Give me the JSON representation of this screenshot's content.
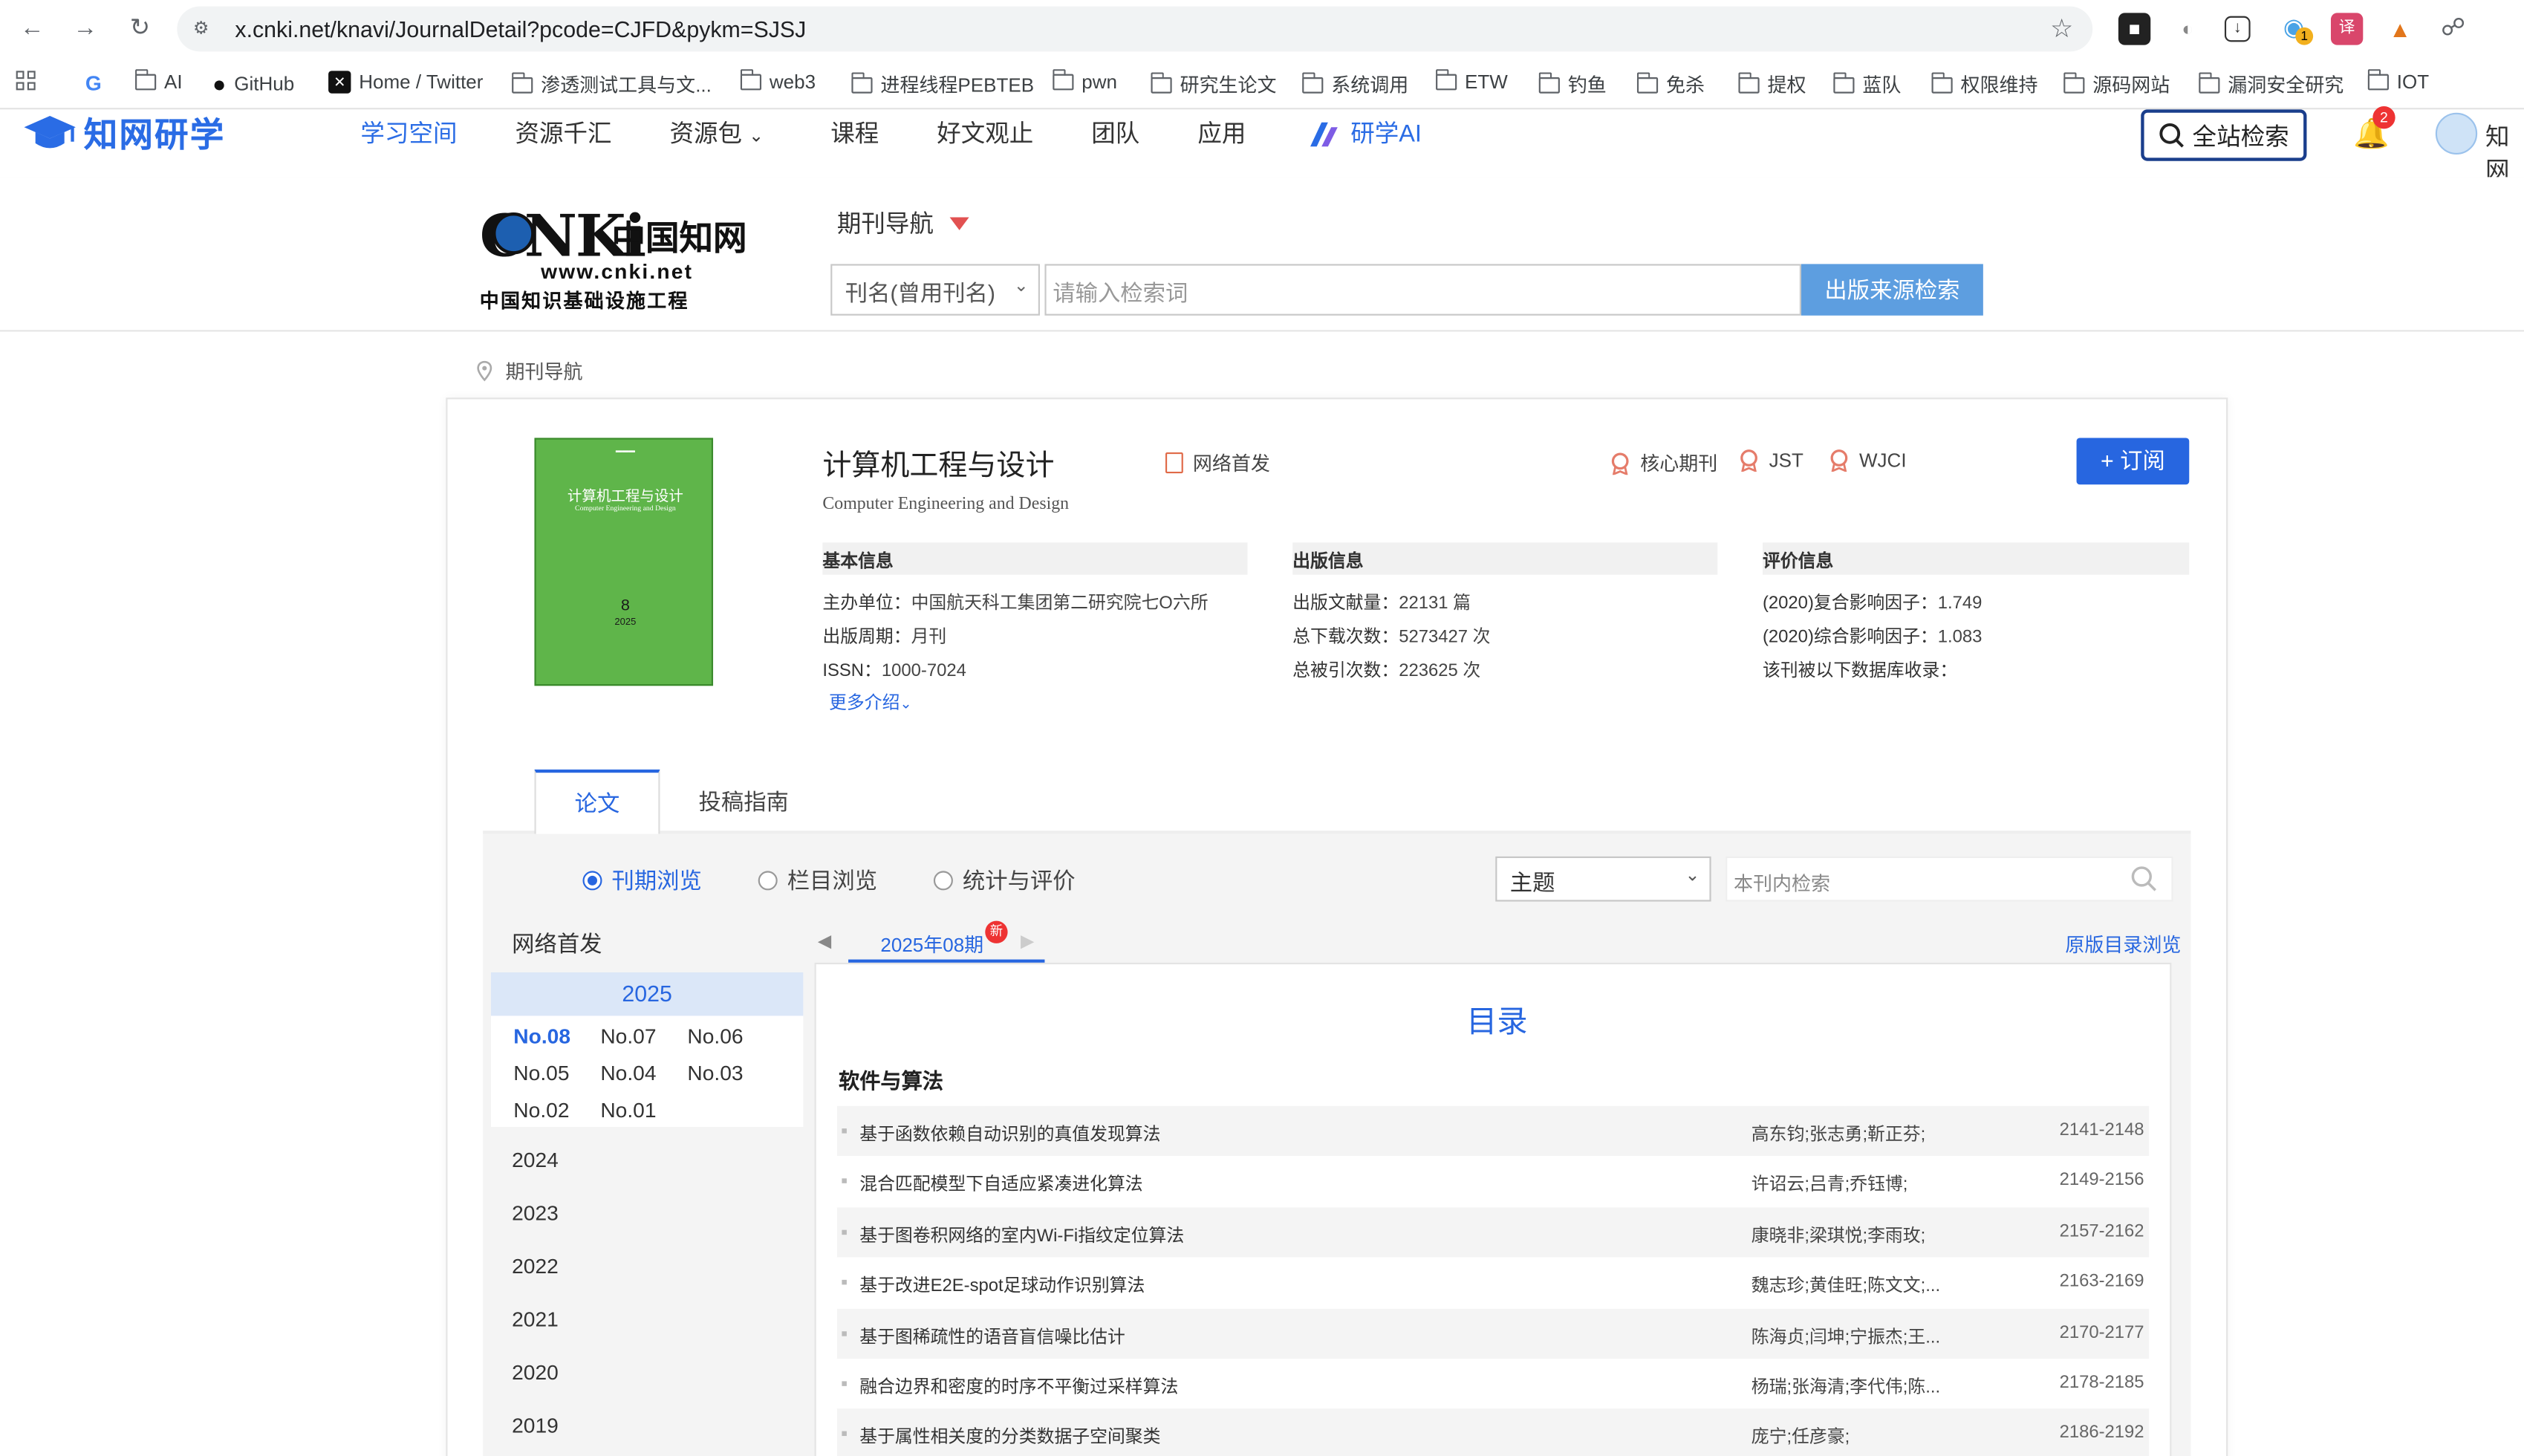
{
  "browser": {
    "url": "x.cnki.net/knavi/JournalDetail?pcode=CJFD&pykm=SJSJ",
    "bookmarks": [
      {
        "label": "AI",
        "icon": "folder-icon"
      },
      {
        "label": "GitHub",
        "icon": "github-icon"
      },
      {
        "label": "Home / Twitter",
        "icon": "x-icon"
      },
      {
        "label": "渗透测试工具与文...",
        "icon": "folder-icon"
      },
      {
        "label": "web3",
        "icon": "folder-icon"
      },
      {
        "label": "进程线程PEBTEB",
        "icon": "folder-icon"
      },
      {
        "label": "pwn",
        "icon": "folder-icon"
      },
      {
        "label": "研究生论文",
        "icon": "folder-icon"
      },
      {
        "label": "系统调用",
        "icon": "folder-icon"
      },
      {
        "label": "ETW",
        "icon": "folder-icon"
      },
      {
        "label": "钓鱼",
        "icon": "folder-icon"
      },
      {
        "label": "免杀",
        "icon": "folder-icon"
      },
      {
        "label": "提权",
        "icon": "folder-icon"
      },
      {
        "label": "蓝队",
        "icon": "folder-icon"
      },
      {
        "label": "权限维持",
        "icon": "folder-icon"
      },
      {
        "label": "源码网站",
        "icon": "folder-icon"
      },
      {
        "label": "漏洞安全研究",
        "icon": "folder-icon"
      },
      {
        "label": "IOT",
        "icon": "folder-icon"
      }
    ],
    "extension_badge": "1"
  },
  "site_header": {
    "logo_text": "知网研学",
    "nav": [
      "学习空间",
      "资源千汇",
      "资源包",
      "课程",
      "好文观止",
      "团队",
      "应用",
      "研学AI"
    ],
    "active_nav": "学习空间",
    "search_all": "全站检索",
    "notification_count": "2",
    "user_name": "知网"
  },
  "cnki_header": {
    "logo_big": "CNKi",
    "logo_cn": "中国知网",
    "logo_www": "www.cnki.net",
    "logo_sub": "中国知识基础设施工程",
    "journal_nav": "期刊导航",
    "field_select": "刊名(曾用刊名)",
    "search_placeholder": "请输入检索词",
    "search_button": "出版来源检索"
  },
  "breadcrumb": "期刊导航",
  "journal": {
    "title": "计算机工程与设计",
    "title_en": "Computer Engineering and Design",
    "online_first": "网络首发",
    "badges": [
      "核心期刊",
      "JST",
      "WJCI"
    ],
    "subscribe": "+ 订阅",
    "cover": {
      "title": "计算机工程与设计",
      "title_en": "Computer Engineering and Design",
      "issue": "8",
      "year": "2025",
      "color": "#5fb54a"
    },
    "basic": {
      "header": "基本信息",
      "rows": [
        {
          "label": "主办单位：",
          "value": "中国航天科工集团第二研究院七O六所"
        },
        {
          "label": "出版周期：",
          "value": "月刊"
        },
        {
          "label": "ISSN：",
          "value": "1000-7024"
        }
      ],
      "more": "更多介绍"
    },
    "publish": {
      "header": "出版信息",
      "rows": [
        {
          "label": "出版文献量：",
          "value": "22131 篇"
        },
        {
          "label": "总下载次数：",
          "value": "5273427 次"
        },
        {
          "label": "总被引次数：",
          "value": "223625 次"
        }
      ]
    },
    "eval": {
      "header": "评价信息",
      "rows": [
        {
          "label": "(2020)复合影响因子：",
          "value": "1.749"
        },
        {
          "label": "(2020)综合影响因子：",
          "value": "1.083"
        },
        {
          "label": "该刊被以下数据库收录：",
          "value": ""
        }
      ]
    }
  },
  "tabs": [
    "论文",
    "投稿指南"
  ],
  "browse_modes": [
    "刊期浏览",
    "栏目浏览",
    "统计与评价"
  ],
  "active_browse_mode": "刊期浏览",
  "theme_select": "主题",
  "in_search_placeholder": "本刊内检索",
  "sidebar": {
    "title": "网络首发",
    "current_year": "2025",
    "issues": [
      "No.08",
      "No.07",
      "No.06",
      "No.05",
      "No.04",
      "No.03",
      "No.02",
      "No.01"
    ],
    "current_issue": "No.08",
    "years": [
      "2024",
      "2023",
      "2022",
      "2021",
      "2020",
      "2019"
    ]
  },
  "issue_tab": "2025年08期",
  "new_badge": "新",
  "original_toc_link": "原版目录浏览",
  "toc": {
    "title": "目录",
    "section": "软件与算法",
    "rows": [
      {
        "title": "基于函数依赖自动识别的真值发现算法",
        "authors": "高东钧;张志勇;靳正芬;",
        "pages": "2141-2148"
      },
      {
        "title": "混合匹配模型下自适应紧凑进化算法",
        "authors": "许诏云;吕青;乔钰博;",
        "pages": "2149-2156"
      },
      {
        "title": "基于图卷积网络的室内Wi-Fi指纹定位算法",
        "authors": "康晓非;梁琪悦;李雨玫;",
        "pages": "2157-2162"
      },
      {
        "title": "基于改进E2E-spot足球动作识别算法",
        "authors": "魏志珍;黄佳旺;陈文文;...",
        "pages": "2163-2169"
      },
      {
        "title": "基于图稀疏性的语音盲信噪比估计",
        "authors": "陈海贞;闫坤;宁振杰;王...",
        "pages": "2170-2177"
      },
      {
        "title": "融合边界和密度的时序不平衡过采样算法",
        "authors": "杨瑞;张海清;李代伟;陈...",
        "pages": "2178-2185"
      },
      {
        "title": "基于属性相关度的分类数据子空间聚类",
        "authors": "庞宁;任彦豪;",
        "pages": "2186-2192"
      }
    ]
  }
}
